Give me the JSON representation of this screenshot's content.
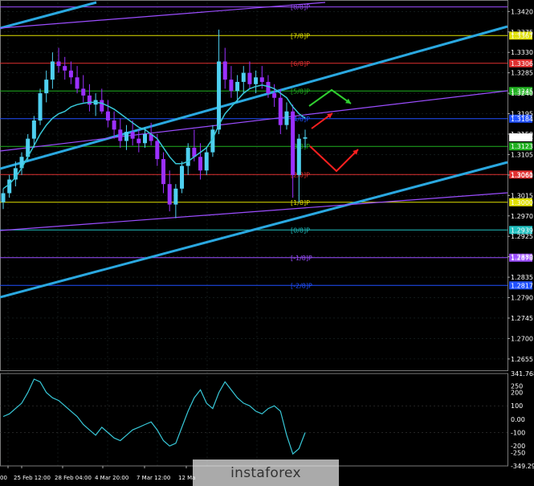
{
  "chart_data": {
    "type": "candlestick",
    "price_axis": {
      "ylim": [
        1.263,
        1.344
      ],
      "ticks": [
        "1.3420",
        "1.3375",
        "1.3330",
        "1.3285",
        "1.3240",
        "1.3195",
        "1.3150",
        "1.3105",
        "1.3060",
        "1.3015",
        "1.2970",
        "1.2925",
        "1.2880",
        "1.2835",
        "1.2790",
        "1.2745",
        "1.2700",
        "1.2655"
      ]
    },
    "x_ticks": [
      "00",
      "25 Feb 12:00",
      "28 Feb 04:00",
      "4 Mar 20:00",
      "7 Mar 12:00",
      "12 Ma"
    ],
    "murrey_levels": [
      {
        "label": "[8/8]P",
        "price": 1.343,
        "color": "#9b4dff",
        "badge": ""
      },
      {
        "label": "[7/8]P",
        "price": 1.3367,
        "color": "#e0e000",
        "badge": "1.3367"
      },
      {
        "label": "[6/8]P",
        "price": 1.3306,
        "color": "#e03030",
        "badge": "1.3306"
      },
      {
        "label": "[5/8]P",
        "price": 1.3245,
        "color": "#20b020",
        "badge": "1.3245"
      },
      {
        "label": "[4/8]P",
        "price": 1.3184,
        "color": "#2050ff",
        "badge": "1.3184"
      },
      {
        "label": "[3/8]P",
        "price": 1.3123,
        "color": "#20b020",
        "badge": "1.3123"
      },
      {
        "label": "[2/8]P",
        "price": 1.3061,
        "color": "#e03030",
        "badge": "1.3061"
      },
      {
        "label": "[1/8]P",
        "price": 1.3,
        "color": "#e0e000",
        "badge": "1.3000"
      },
      {
        "label": "[0/8]P",
        "price": 1.2939,
        "color": "#20c0c0",
        "badge": "1.2939"
      },
      {
        "label": "[-1/8]P",
        "price": 1.2878,
        "color": "#9b4dff",
        "badge": "1.2878"
      },
      {
        "label": "[-2/8]P",
        "price": 1.2817,
        "color": "#2050ff",
        "badge": "1.2817"
      }
    ],
    "current_price": "1.3143",
    "candles": [
      [
        1.3,
        1.303,
        1.2985,
        1.302
      ],
      [
        1.302,
        1.306,
        1.301,
        1.305
      ],
      [
        1.305,
        1.309,
        1.3035,
        1.3075
      ],
      [
        1.3075,
        1.311,
        1.306,
        1.31
      ],
      [
        1.31,
        1.315,
        1.309,
        1.314
      ],
      [
        1.314,
        1.319,
        1.312,
        1.318
      ],
      [
        1.318,
        1.325,
        1.317,
        1.324
      ],
      [
        1.324,
        1.329,
        1.322,
        1.327
      ],
      [
        1.327,
        1.333,
        1.325,
        1.331
      ],
      [
        1.331,
        1.334,
        1.3285,
        1.33
      ],
      [
        1.33,
        1.332,
        1.327,
        1.329
      ],
      [
        1.329,
        1.331,
        1.326,
        1.3275
      ],
      [
        1.3275,
        1.33,
        1.324,
        1.325
      ],
      [
        1.325,
        1.328,
        1.322,
        1.3235
      ],
      [
        1.3235,
        1.326,
        1.32,
        1.3215
      ],
      [
        1.3215,
        1.324,
        1.319,
        1.3225
      ],
      [
        1.3225,
        1.325,
        1.3195,
        1.32
      ],
      [
        1.32,
        1.3225,
        1.3165,
        1.318
      ],
      [
        1.318,
        1.32,
        1.314,
        1.316
      ],
      [
        1.316,
        1.3185,
        1.312,
        1.3135
      ],
      [
        1.3135,
        1.317,
        1.3115,
        1.3155
      ],
      [
        1.3155,
        1.318,
        1.3125,
        1.314
      ],
      [
        1.314,
        1.316,
        1.311,
        1.313
      ],
      [
        1.313,
        1.3165,
        1.312,
        1.315
      ],
      [
        1.315,
        1.3175,
        1.3125,
        1.3135
      ],
      [
        1.3135,
        1.315,
        1.308,
        1.3095
      ],
      [
        1.3095,
        1.311,
        1.302,
        1.304
      ],
      [
        1.304,
        1.307,
        1.298,
        1.2995
      ],
      [
        1.2995,
        1.304,
        1.2965,
        1.303
      ],
      [
        1.303,
        1.309,
        1.302,
        1.308
      ],
      [
        1.308,
        1.313,
        1.306,
        1.312
      ],
      [
        1.312,
        1.316,
        1.309,
        1.31
      ],
      [
        1.31,
        1.313,
        1.305,
        1.307
      ],
      [
        1.307,
        1.312,
        1.306,
        1.311
      ],
      [
        1.311,
        1.317,
        1.31,
        1.316
      ],
      [
        1.316,
        1.338,
        1.315,
        1.331
      ],
      [
        1.331,
        1.334,
        1.325,
        1.327
      ],
      [
        1.327,
        1.33,
        1.323,
        1.3245
      ],
      [
        1.3245,
        1.328,
        1.322,
        1.3265
      ],
      [
        1.3265,
        1.33,
        1.324,
        1.3285
      ],
      [
        1.3285,
        1.331,
        1.325,
        1.326
      ],
      [
        1.326,
        1.329,
        1.324,
        1.3275
      ],
      [
        1.3275,
        1.33,
        1.325,
        1.3265
      ],
      [
        1.3265,
        1.328,
        1.323,
        1.324
      ],
      [
        1.324,
        1.326,
        1.321,
        1.323
      ],
      [
        1.323,
        1.325,
        1.315,
        1.317
      ],
      [
        1.317,
        1.322,
        1.316,
        1.32
      ],
      [
        1.32,
        1.3215,
        1.301,
        1.306
      ],
      [
        1.306,
        1.315,
        1.3,
        1.314
      ],
      [
        1.314,
        1.316,
        1.312,
        1.3143
      ]
    ],
    "moving_average": [
      1.303,
      1.304,
      1.3055,
      1.3075,
      1.31,
      1.3125,
      1.315,
      1.317,
      1.3185,
      1.3195,
      1.32,
      1.321,
      1.3215,
      1.3218,
      1.322,
      1.322,
      1.3218,
      1.3212,
      1.3205,
      1.3195,
      1.3185,
      1.3175,
      1.3165,
      1.316,
      1.315,
      1.314,
      1.312,
      1.31,
      1.3085,
      1.3085,
      1.309,
      1.31,
      1.311,
      1.312,
      1.314,
      1.317,
      1.3195,
      1.321,
      1.3225,
      1.324,
      1.325,
      1.3255,
      1.3258,
      1.3255,
      1.325,
      1.324,
      1.323,
      1.321,
      1.3195,
      1.3185
    ],
    "oscillator": {
      "ylim": [
        -349.291,
        341.7683
      ],
      "ticks": [
        "341.7683",
        "250",
        "200",
        "100",
        "0.00",
        "-100",
        "-200",
        "-250",
        "-349.291"
      ],
      "values": [
        20,
        40,
        80,
        120,
        200,
        300,
        280,
        200,
        160,
        140,
        100,
        60,
        20,
        -40,
        -80,
        -120,
        -60,
        -100,
        -140,
        -160,
        -120,
        -80,
        -60,
        -40,
        -20,
        -80,
        -160,
        -200,
        -180,
        -60,
        60,
        160,
        220,
        120,
        80,
        200,
        280,
        220,
        160,
        120,
        100,
        60,
        40,
        80,
        100,
        60,
        -120,
        -260,
        -220,
        -100
      ]
    }
  },
  "watermark": "instaforex"
}
